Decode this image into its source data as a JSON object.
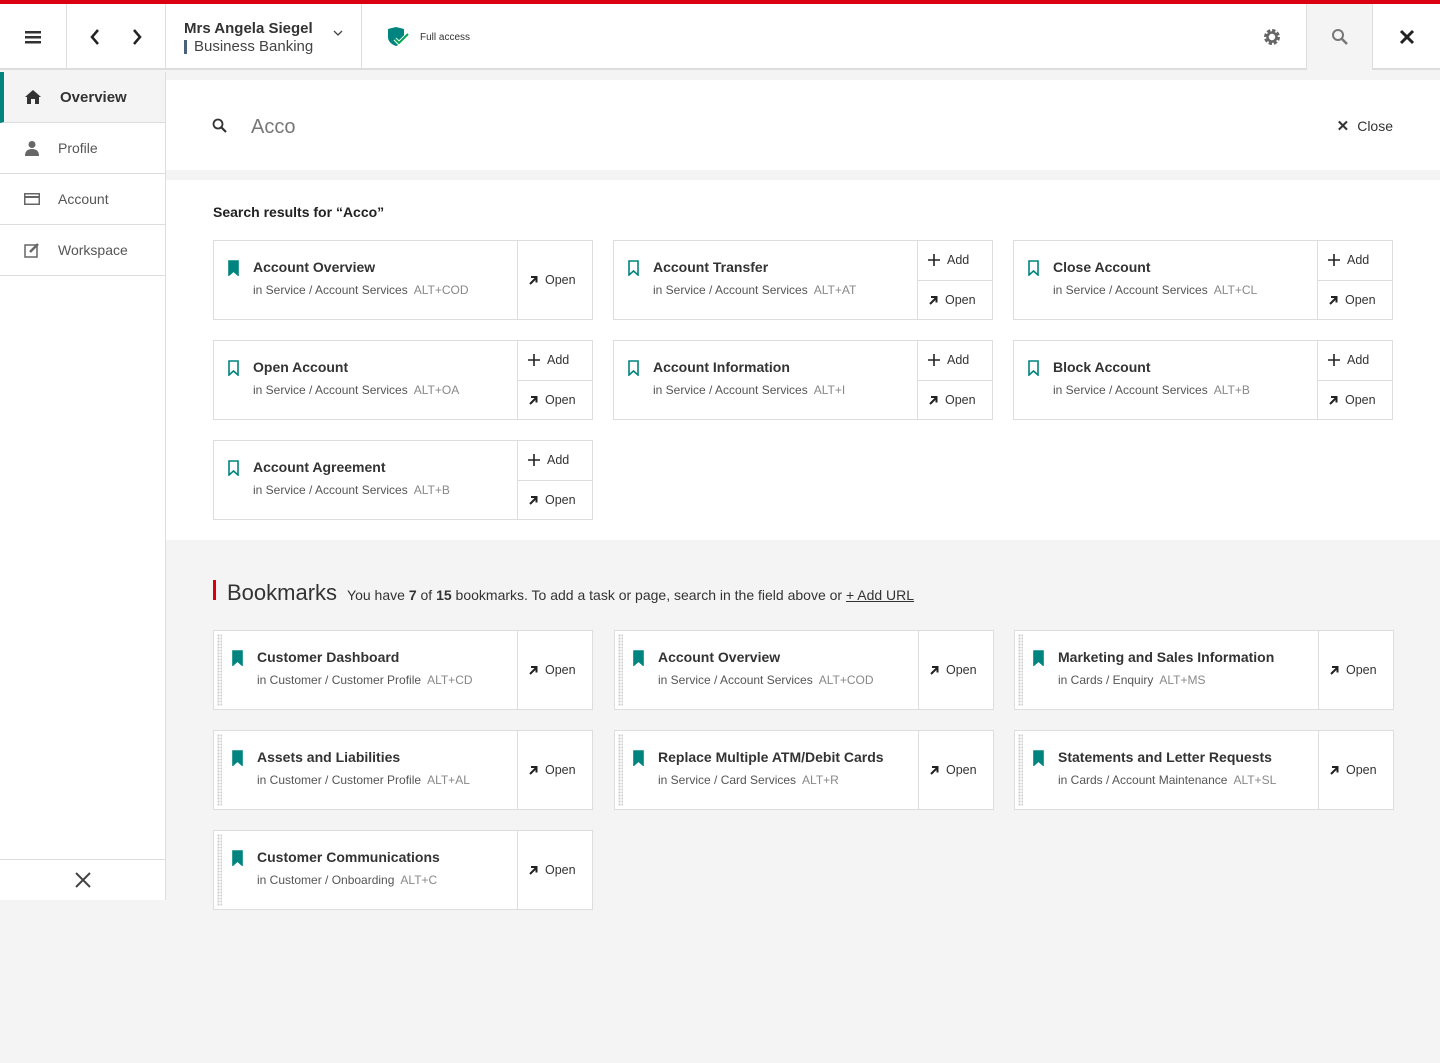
{
  "header": {
    "customer_name": "Mrs Angela Siegel",
    "segment": "Business Banking",
    "access_label": "Full access",
    "accent_color": "#db0011",
    "brand_teal": "#00847f"
  },
  "sidebar": {
    "items": [
      {
        "label": "Overview",
        "icon": "home-icon",
        "active": true
      },
      {
        "label": "Profile",
        "icon": "person-icon"
      },
      {
        "label": "Account",
        "icon": "card-icon"
      },
      {
        "label": "Workspace",
        "icon": "edit-icon"
      }
    ]
  },
  "search": {
    "query": "Acco",
    "close_label": "Close"
  },
  "results": {
    "heading": "Search results for “Acco”",
    "add_label": "Add",
    "open_label": "Open",
    "items": [
      {
        "title": "Account Overview",
        "path": "in Service / Account Services",
        "shortcut": "ALT+COD",
        "bookmarked": true
      },
      {
        "title": "Account Transfer",
        "path": "in Service / Account Services",
        "shortcut": "ALT+AT",
        "bookmarked": false
      },
      {
        "title": "Close Account",
        "path": "in Service / Account Services",
        "shortcut": "ALT+CL",
        "bookmarked": false
      },
      {
        "title": "Open Account",
        "path": "in Service / Account Services",
        "shortcut": "ALT+OA",
        "bookmarked": false
      },
      {
        "title": "Account Information",
        "path": "in Service / Account Services",
        "shortcut": "ALT+I",
        "bookmarked": false
      },
      {
        "title": "Block Account",
        "path": "in Service / Account Services",
        "shortcut": "ALT+B",
        "bookmarked": false
      },
      {
        "title": "Account Agreement",
        "path": "in Service / Account Services",
        "shortcut": "ALT+B",
        "bookmarked": false
      }
    ]
  },
  "bookmarks": {
    "heading": "Bookmarks",
    "text_1": "You have ",
    "count": "7",
    "text_2": " of ",
    "max": "15",
    "text_3": " bookmarks. To add a task or page, search in the field above or ",
    "add_url_label": "+ Add URL",
    "open_label": "Open",
    "items": [
      {
        "title": "Customer Dashboard",
        "path": "in Customer / Customer Profile",
        "shortcut": "ALT+CD"
      },
      {
        "title": "Account Overview",
        "path": "in Service / Account Services",
        "shortcut": "ALT+COD"
      },
      {
        "title": "Marketing and Sales Information",
        "path": "in Cards / Enquiry",
        "shortcut": "ALT+MS"
      },
      {
        "title": "Assets and Liabilities",
        "path": "in Customer / Customer Profile",
        "shortcut": "ALT+AL"
      },
      {
        "title": "Replace Multiple ATM/Debit Cards",
        "path": "in Service / Card Services",
        "shortcut": "ALT+R"
      },
      {
        "title": "Statements and Letter Requests",
        "path": "in Cards / Account Maintenance",
        "shortcut": "ALT+SL"
      },
      {
        "title": "Customer Communications",
        "path": "in Customer / Onboarding",
        "shortcut": "ALT+C"
      }
    ]
  }
}
